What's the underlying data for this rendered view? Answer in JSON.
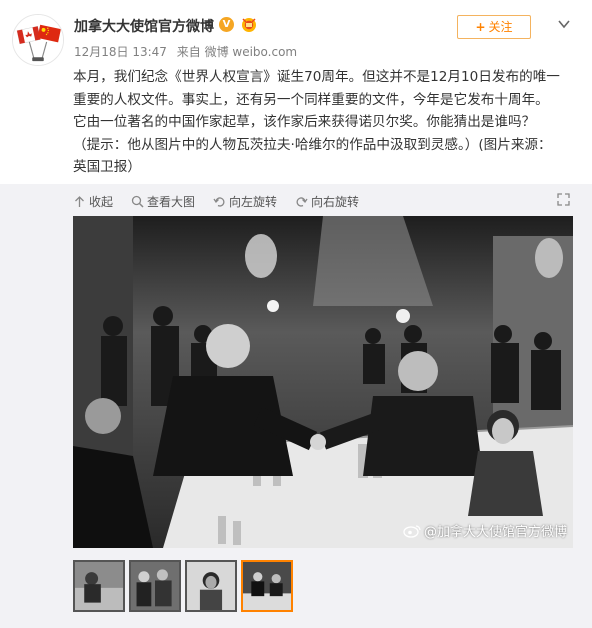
{
  "post": {
    "author": "加拿大大使馆官方微博",
    "timestamp": "12月18日 13:47",
    "source": "来自 微博 weibo.com",
    "follow_label": "关注",
    "follow_plus": "+",
    "text_lines": [
      "本月，我们纪念《世界人权宣言》诞生70周年。但这并不是12月10日发布的唯一",
      "重要的人权文件。事实上，还有另一个同样重要的文件，今年是它发布十周年。",
      "它由一位著名的中国作家起草，该作家后来获得诺贝尔奖。你能猜出是谁吗？",
      "（提示：他从图片中的人物瓦茨拉夫·哈维尔的作品中汲取到灵感。）(图片来源：",
      "英国卫报）"
    ]
  },
  "media": {
    "toolbar": {
      "collapse": "收起",
      "view_large": "查看大图",
      "rotate_left": "向左旋转",
      "rotate_right": "向右旋转"
    },
    "watermark": "@加拿大大使馆官方微博",
    "thumbnails": [
      {
        "name": "thumb-1",
        "active": false
      },
      {
        "name": "thumb-2",
        "active": false
      },
      {
        "name": "thumb-3",
        "active": false
      },
      {
        "name": "thumb-4",
        "active": true
      }
    ]
  },
  "colors": {
    "accent": "#ff8200",
    "meta_text": "#808080",
    "media_bg": "#f2f2f5"
  },
  "icons": [
    "avatar-flags",
    "verified-icon",
    "gov-badge-icon",
    "chevron-down-icon",
    "collapse-icon",
    "zoom-icon",
    "rotate-left-icon",
    "rotate-right-icon",
    "expand-icon",
    "weibo-logo-icon"
  ]
}
